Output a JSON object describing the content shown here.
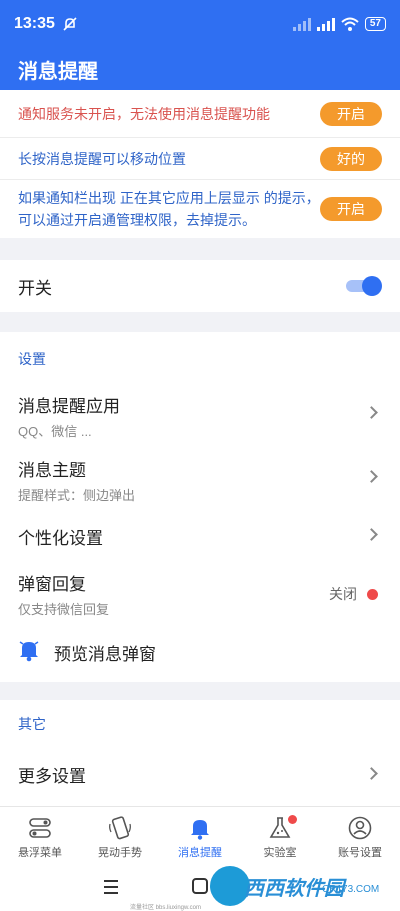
{
  "status": {
    "time": "13:35",
    "battery": "57"
  },
  "header": {
    "title": "消息提醒"
  },
  "notices": [
    {
      "text": "通知服务未开启，无法使用消息提醒功能",
      "button": "开启"
    },
    {
      "text": "长按消息提醒可以移动位置",
      "button": "好的"
    },
    {
      "text": "如果通知栏出现 正在其它应用上层显示 的提示，可以通过开启通管理权限，去掉提示。",
      "button": "开启"
    }
  ],
  "switch": {
    "label": "开关",
    "on": true
  },
  "settings": {
    "title": "设置",
    "app": {
      "title": "消息提醒应用",
      "sub": "QQ、微信 ..."
    },
    "theme": {
      "title": "消息主题",
      "sub": "提醒样式：侧边弹出"
    },
    "personal": {
      "title": "个性化设置"
    },
    "reply": {
      "title": "弹窗回复",
      "sub": "仅支持微信回复",
      "state": "关闭"
    },
    "preview": {
      "title": "预览消息弹窗"
    }
  },
  "other": {
    "title": "其它",
    "more": "更多设置"
  },
  "tabs": [
    {
      "label": "悬浮菜单",
      "icon": "toggle-menu-icon"
    },
    {
      "label": "晃动手势",
      "icon": "shake-phone-icon"
    },
    {
      "label": "消息提醒",
      "icon": "bell-icon"
    },
    {
      "label": "实验室",
      "icon": "flask-icon"
    },
    {
      "label": "账号设置",
      "icon": "account-icon"
    }
  ],
  "watermark": {
    "brand": "西西软件园",
    "site": "CR173.COM"
  },
  "footer": {
    "note": "流量社区 bbs.liuxingw.com"
  },
  "colors": {
    "primary": "#2f6ff2",
    "warning": "#f49a2c",
    "error": "#d9534f",
    "link": "#2f64c8"
  }
}
